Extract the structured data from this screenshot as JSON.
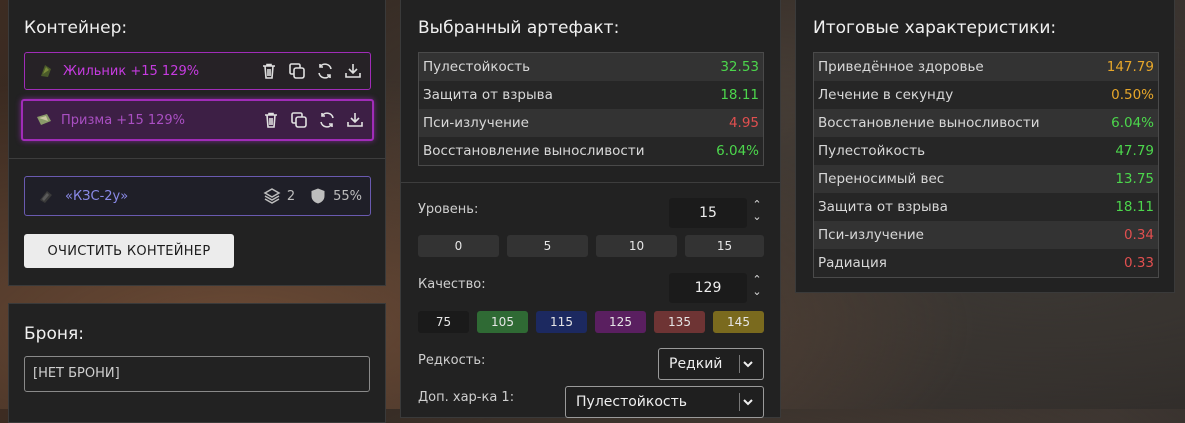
{
  "container": {
    "title": "Контейнер:",
    "artifacts": [
      {
        "name": "Жильник +15 129%",
        "icon": "artifact-green-icon"
      },
      {
        "name": "Призма +15 129%",
        "icon": "artifact-prism-icon"
      }
    ],
    "case": {
      "name": "«КЗС-2у»",
      "slots": "2",
      "protection": "55%"
    },
    "clear_label": "ОЧИСТИТЬ КОНТЕЙНЕР"
  },
  "armor": {
    "title": "Броня:",
    "value": "[НЕТ БРОНИ]"
  },
  "artifact": {
    "title": "Выбранный артефакт:",
    "stats": [
      {
        "label": "Пулестойкость",
        "value": "32.53",
        "color": "green"
      },
      {
        "label": "Защита от взрыва",
        "value": "18.11",
        "color": "green"
      },
      {
        "label": "Пси-излучение",
        "value": "4.95",
        "color": "red"
      },
      {
        "label": "Восстановление выносливости",
        "value": "6.04%",
        "color": "green"
      }
    ],
    "level_label": "Уровень:",
    "level_value": "15",
    "level_presets": [
      "0",
      "5",
      "10",
      "15"
    ],
    "quality_label": "Качество:",
    "quality_value": "129",
    "quality_presets": [
      {
        "label": "75",
        "color": "#1a1a1a"
      },
      {
        "label": "105",
        "color": "#2f6a34"
      },
      {
        "label": "115",
        "color": "#1c2960"
      },
      {
        "label": "125",
        "color": "#5a1f60"
      },
      {
        "label": "135",
        "color": "#6e3434"
      },
      {
        "label": "145",
        "color": "#7a6a1e"
      }
    ],
    "rarity_label": "Редкость:",
    "rarity_value": "Редкий",
    "extra_label": "Доп. хар-ка 1:",
    "extra_value": "Пулестойкость"
  },
  "result": {
    "title": "Итоговые характеристики:",
    "stats": [
      {
        "label": "Приведённое здоровье",
        "value": "147.79",
        "color": "orange"
      },
      {
        "label": "Лечение в секунду",
        "value": "0.50%",
        "color": "orange"
      },
      {
        "label": "Восстановление выносливости",
        "value": "6.04%",
        "color": "green"
      },
      {
        "label": "Пулестойкость",
        "value": "47.79",
        "color": "green"
      },
      {
        "label": "Переносимый вес",
        "value": "13.75",
        "color": "green"
      },
      {
        "label": "Защита от взрыва",
        "value": "18.11",
        "color": "green"
      },
      {
        "label": "Пси-излучение",
        "value": "0.34",
        "color": "red"
      },
      {
        "label": "Радиация",
        "value": "0.33",
        "color": "red"
      }
    ]
  }
}
